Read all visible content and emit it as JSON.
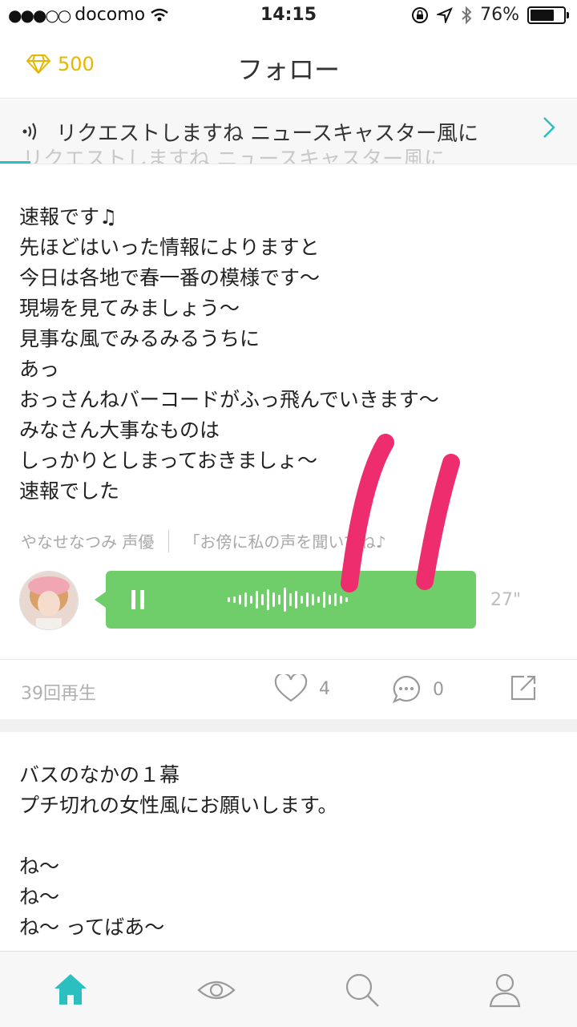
{
  "status": {
    "carrier": "docomo",
    "time": "14:15",
    "battery": "76%",
    "battery_level": 0.76
  },
  "header": {
    "gems": "500",
    "title": "フォロー"
  },
  "banner": {
    "text": "リクエストしますね ニュースキャスター風に",
    "ghost_text": "リクエストしますね ニュースキャスター風に"
  },
  "post1": {
    "body": "速報です♫\n先ほどはいった情報によりますと\n今日は各地で春一番の模様です〜\n現場を見てみましょう〜\n見事な風でみるみるうちに\nあっ\nおっさんねバーコードがふっ飛んでいきます〜\nみなさん大事なものは\nしっかりとしまっておきましょ〜\n速報でした",
    "author": "やなせなつみ 声優",
    "quote": "「お傍に私の声を聞いてね♪",
    "duration": "27\"",
    "plays": "39回再生",
    "likes": "4",
    "comments": "0"
  },
  "post2": {
    "body": "バスのなかの１幕\nプチ切れの女性風にお願いします。\n\nね〜\nね〜\nね〜 ってばあ〜"
  },
  "colors": {
    "accent": "#2bbfbf",
    "player": "#6fce6a",
    "gem": "#e6b700",
    "marker": "#ee2d6e"
  },
  "icons": [
    "signal-dots-icon",
    "wifi-icon",
    "lock-rotation-icon",
    "location-icon",
    "bluetooth-icon",
    "battery-icon",
    "gem-icon",
    "speaker-icon",
    "chevron-right-icon",
    "pause-icon",
    "waveform-icon",
    "heart-icon",
    "comment-icon",
    "share-icon",
    "home-icon",
    "eye-icon",
    "search-icon",
    "profile-icon"
  ]
}
